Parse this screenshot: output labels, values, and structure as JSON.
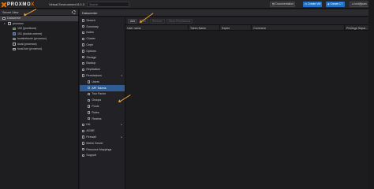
{
  "header": {
    "logo_prefix": "PROXMO",
    "logo_suffix": "X",
    "version": "Virtual Environment 8.0.3",
    "search_placeholder": "Search",
    "documentation": "Documentation",
    "create_vm": "Create VM",
    "create_ct": "Create CT",
    "user": "root@pam"
  },
  "tree": {
    "view_label": "Server View",
    "items": [
      {
        "label": "Datacenter",
        "icon": "datacenter-icon",
        "selected": true
      },
      {
        "label": "proxmox",
        "icon": "server-icon"
      },
      {
        "label": "100 (ipnetbum)",
        "icon": "vm-icon"
      },
      {
        "label": "101 (docker-server)",
        "icon": "container-icon"
      },
      {
        "label": "localnetwork (proxmox)",
        "icon": "network-icon"
      },
      {
        "label": "local (proxmox)",
        "icon": "storage-icon"
      },
      {
        "label": "local-lvm (proxmox)",
        "icon": "storage-icon"
      }
    ]
  },
  "breadcrumb": "Datacenter",
  "nav": {
    "items": [
      {
        "label": "Search",
        "icon": "search-icon"
      },
      {
        "label": "Summary",
        "icon": "summary-icon"
      },
      {
        "label": "Notes",
        "icon": "notes-icon"
      },
      {
        "label": "Cluster",
        "icon": "cluster-icon"
      },
      {
        "label": "Ceph",
        "icon": "ceph-icon"
      },
      {
        "label": "Options",
        "icon": "gear-icon"
      },
      {
        "label": "Storage",
        "icon": "storage-icon"
      },
      {
        "label": "Backup",
        "icon": "backup-icon"
      },
      {
        "label": "Replication",
        "icon": "replication-icon"
      },
      {
        "label": "Permissions",
        "icon": "lock-icon",
        "chevron": "▾"
      },
      {
        "label": "Users",
        "icon": "user-icon",
        "sub": true
      },
      {
        "label": "API Tokens",
        "icon": "token-icon",
        "sub": true,
        "active": true
      },
      {
        "label": "Two Factor",
        "icon": "key-icon",
        "sub": true
      },
      {
        "label": "Groups",
        "icon": "group-icon",
        "sub": true
      },
      {
        "label": "Pools",
        "icon": "pool-icon",
        "sub": true
      },
      {
        "label": "Roles",
        "icon": "role-icon",
        "sub": true
      },
      {
        "label": "Realms",
        "icon": "realm-icon",
        "sub": true
      },
      {
        "label": "HA",
        "icon": "ha-icon",
        "chevron": "▸"
      },
      {
        "label": "ACME",
        "icon": "certificate-icon"
      },
      {
        "label": "Firewall",
        "icon": "firewall-icon",
        "chevron": "▸"
      },
      {
        "label": "Metric Server",
        "icon": "metric-icon"
      },
      {
        "label": "Resource Mappings",
        "icon": "mapping-icon"
      },
      {
        "label": "Support",
        "icon": "support-icon"
      }
    ]
  },
  "toolbar": {
    "add": "Add",
    "edit": "Edit",
    "remove": "Remove",
    "show_permissions": "Show Permissions"
  },
  "columns": [
    "User name",
    "Token Name",
    "Expire",
    "Comment",
    "Privilege Separ..."
  ],
  "colors": {
    "accent": "#e57000",
    "primary": "#2170c7",
    "selected_nav": "#2f5d93",
    "annotation": "#f0a030"
  }
}
